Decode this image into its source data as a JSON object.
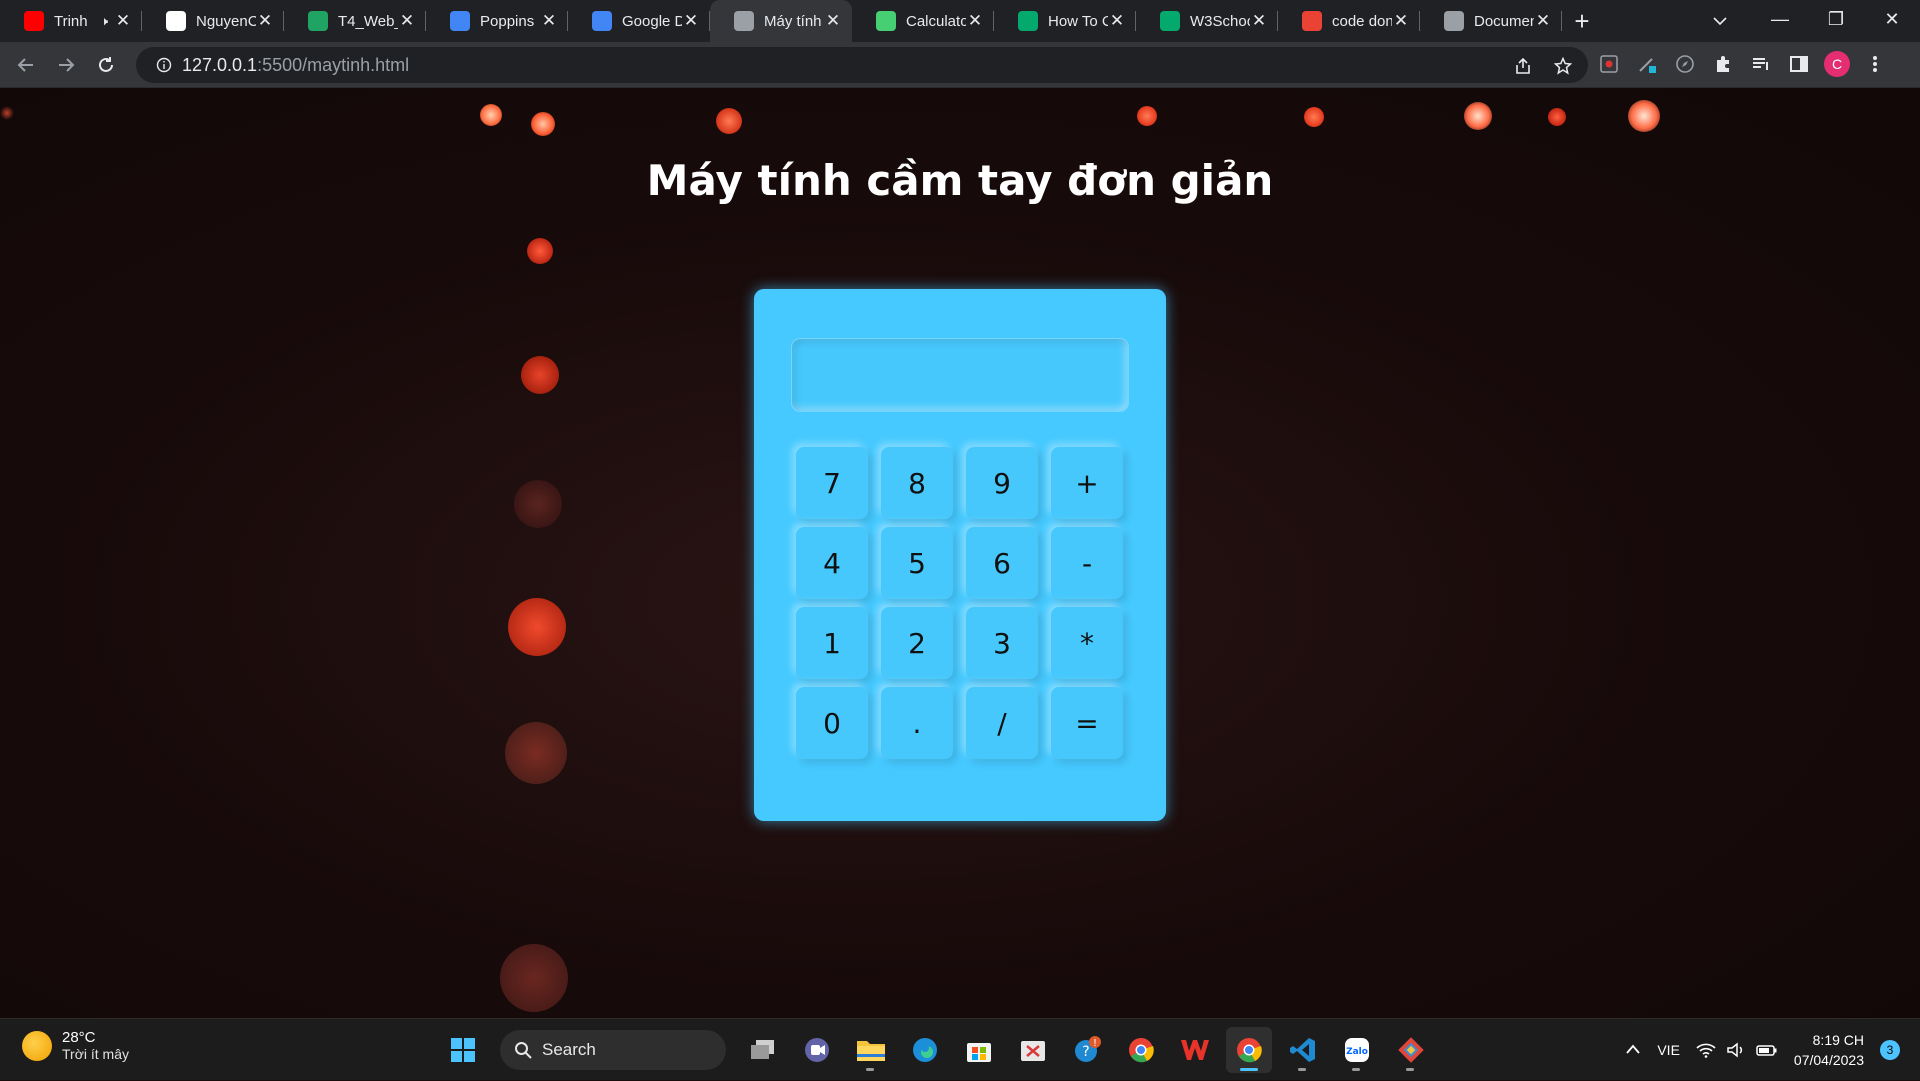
{
  "browser": {
    "tabs": [
      {
        "title": "Trinh",
        "favicon": "youtube-icon",
        "color": "#ff0000",
        "audio": true
      },
      {
        "title": "NguyenC",
        "favicon": "github-icon",
        "color": "#ffffff"
      },
      {
        "title": "T4_Web_",
        "favicon": "sheets-icon",
        "color": "#1fa463"
      },
      {
        "title": "Poppins",
        "favicon": "google-fonts-icon",
        "color": "#4285f4"
      },
      {
        "title": "Google D",
        "favicon": "google-translate-icon",
        "color": "#4285f4"
      },
      {
        "title": "Máy tính",
        "favicon": "globe-icon",
        "color": "#9aa0a6",
        "active": true
      },
      {
        "title": "Calculato",
        "favicon": "codepen-icon",
        "color": "#47cf73"
      },
      {
        "title": "How To C",
        "favicon": "w3schools-icon",
        "color": "#04aa6d"
      },
      {
        "title": "W3Schoo",
        "favicon": "w3schools-icon",
        "color": "#04aa6d"
      },
      {
        "title": "code don",
        "favicon": "google-icon",
        "color": "#ea4335"
      },
      {
        "title": "Documen",
        "favicon": "globe-icon",
        "color": "#9aa0a6"
      }
    ],
    "new_tab": "+",
    "url_host": "127.0.0.1",
    "url_path": ":5500/maytinh.html",
    "profile_initial": "C"
  },
  "page": {
    "title": "Máy tính cầm tay đơn giản"
  },
  "calculator": {
    "display_value": "",
    "keys": [
      "7",
      "8",
      "9",
      "+",
      "4",
      "5",
      "6",
      "-",
      "1",
      "2",
      "3",
      "*",
      "0",
      ".",
      "/",
      "="
    ],
    "body_color": "#45c9ff"
  },
  "taskbar": {
    "temperature": "28°C",
    "weather": "Trời ít mây",
    "search_label": "Search",
    "language": "VIE",
    "time": "8:19 CH",
    "date": "07/04/2023",
    "notification_count": "3"
  }
}
